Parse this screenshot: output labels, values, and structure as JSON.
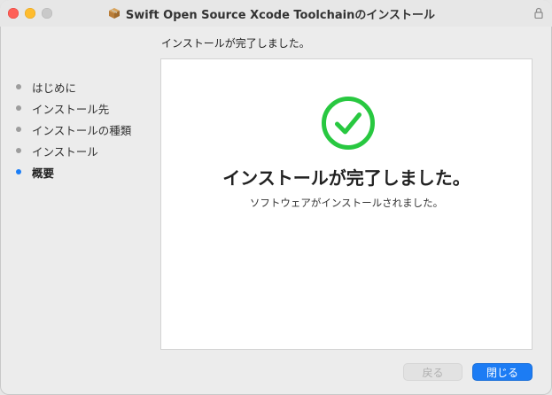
{
  "window": {
    "title": "Swift Open Source Xcode Toolchainのインストール"
  },
  "header": {
    "status_text": "インストールが完了しました。"
  },
  "sidebar": {
    "steps": [
      {
        "label": "はじめに",
        "active": false
      },
      {
        "label": "インストール先",
        "active": false
      },
      {
        "label": "インストールの種類",
        "active": false
      },
      {
        "label": "インストール",
        "active": false
      },
      {
        "label": "概要",
        "active": true
      }
    ]
  },
  "main": {
    "title": "インストールが完了しました。",
    "subtitle": "ソフトウェアがインストールされました。",
    "icon": "checkmark-circle-icon"
  },
  "buttons": {
    "back_label": "戻る",
    "close_label": "閉じる"
  },
  "colors": {
    "accent": "#1c7cf4",
    "success": "#28c840"
  }
}
